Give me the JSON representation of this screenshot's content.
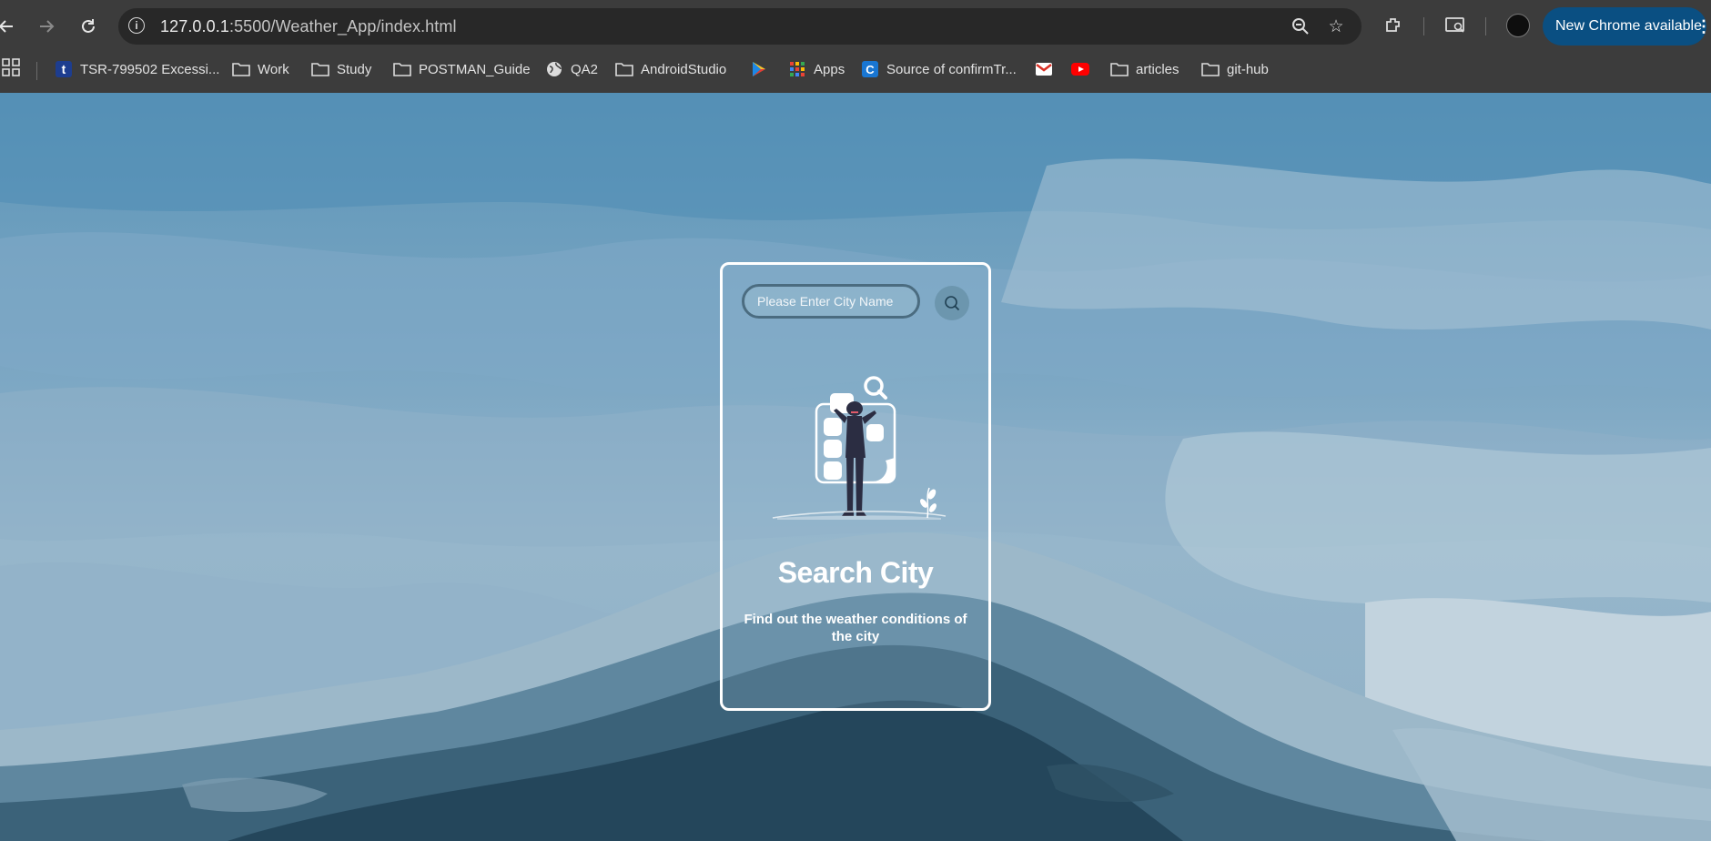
{
  "browser": {
    "url_host": "127.0.0.1",
    "url_path": ":5500/Weather_App/index.html",
    "update_label": "New Chrome available"
  },
  "bookmarks": [
    {
      "label": "TSR-799502 Excessi...",
      "icon": "t-icon"
    },
    {
      "label": "Work",
      "icon": "folder-icon"
    },
    {
      "label": "Study",
      "icon": "folder-icon"
    },
    {
      "label": "POSTMAN_Guide",
      "icon": "folder-icon"
    },
    {
      "label": "QA2",
      "icon": "globe-icon"
    },
    {
      "label": "AndroidStudio",
      "icon": "folder-icon"
    },
    {
      "label": "",
      "icon": "play-store-icon"
    },
    {
      "label": "Apps",
      "icon": "apps-icon"
    },
    {
      "label": "Source of confirmTr...",
      "icon": "blue-c-icon"
    },
    {
      "label": "",
      "icon": "gmail-icon"
    },
    {
      "label": "",
      "icon": "youtube-icon"
    },
    {
      "label": "articles",
      "icon": "folder-icon"
    },
    {
      "label": "git-hub",
      "icon": "folder-icon"
    }
  ],
  "app": {
    "search_placeholder": "Please Enter City Name",
    "search_value": "",
    "title": "Search City",
    "subtitle": "Find out the weather conditions of the city"
  },
  "colors": {
    "accent": "#0a4f82",
    "card_border": "#ffffff",
    "input_border": "#4b6c80"
  }
}
